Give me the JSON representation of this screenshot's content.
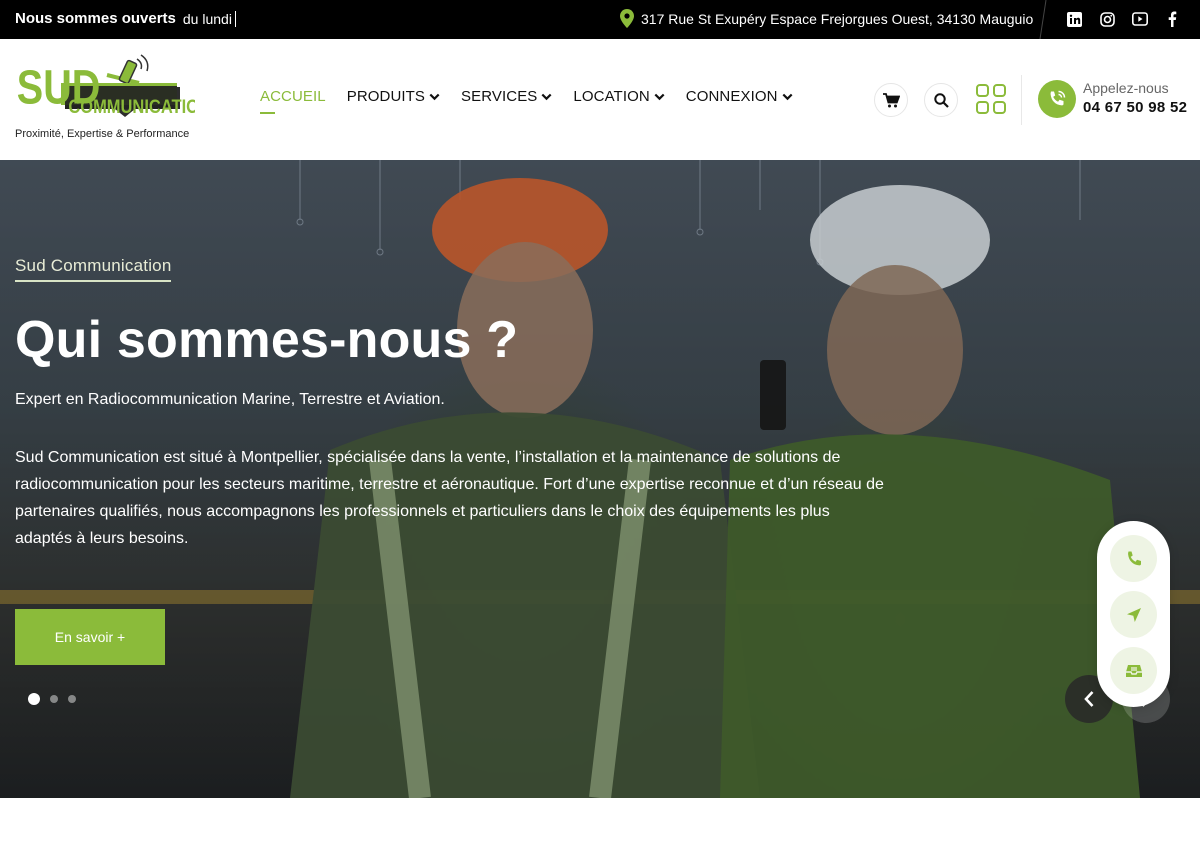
{
  "topbar": {
    "open_label": "Nous sommes ouverts",
    "open_hours": "du lundi",
    "address": "317 Rue St Exupéry Espace Frejorgues Ouest, 34130 Mauguio",
    "social_icons": [
      "linkedin-icon",
      "instagram-icon",
      "youtube-icon",
      "facebook-icon"
    ]
  },
  "header": {
    "logo_text_top": "SUD",
    "logo_text_bottom": "COMMUNICATION",
    "tagline": "Proximité, Expertise & Performance",
    "nav": [
      {
        "label": "ACCUEIL",
        "active": true
      },
      {
        "label": "PRODUITS",
        "dropdown": true
      },
      {
        "label": "SERVICES",
        "dropdown": true
      },
      {
        "label": "LOCATION",
        "dropdown": true
      },
      {
        "label": "CONNEXION",
        "dropdown": true
      }
    ],
    "call_label": "Appelez-nous",
    "call_number": "04 67 50 98 52"
  },
  "hero": {
    "subtitle": "Sud Communication",
    "title": "Qui sommes-nous ?",
    "lead": "Expert en Radiocommunication Marine, Terrestre et Aviation.",
    "body": "Sud Communication est situé à Montpellier, spécialisée dans la vente, l’installation et la maintenance de solutions de radiocommunication pour les secteurs maritime, terrestre et aéronautique. Fort d’une expertise reconnue et d’un réseau de partenaires qualifiés, nous accompagnons les professionnels et particuliers dans le choix des équipements les plus adaptés à leurs besoins.",
    "button_label": "En savoir +",
    "slides_total": 3,
    "slide_active": 1
  },
  "colors": {
    "accent": "#8bbb3a",
    "topbar_bg": "#000000"
  }
}
